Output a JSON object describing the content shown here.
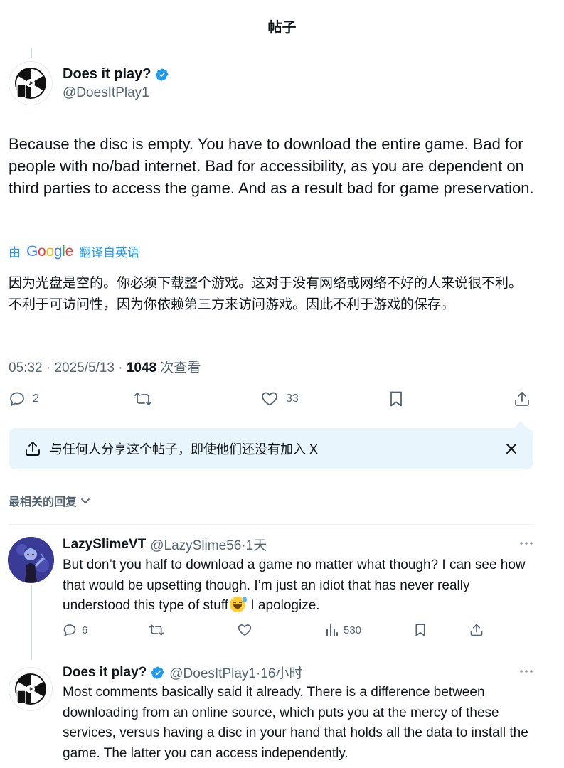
{
  "page": {
    "title": "帖子"
  },
  "post": {
    "author_name": "Does it play?",
    "author_handle": "@DoesItPlay1",
    "text": "Because the disc is empty. You have to download the entire game. Bad for people with no/bad internet. Bad for accessibility, as you are dependent on third parties to access the game. And as a result bad for game preservation.",
    "translate": {
      "by": "由",
      "provider_letters": [
        "G",
        "o",
        "o",
        "g",
        "l",
        "e"
      ],
      "action": "翻译自英语"
    },
    "translated_text": "因为光盘是空的。你必须下载整个游戏。这对于没有网络或网络不好的人来说很不利。不利于可访问性，因为你依赖第三方来访问游戏。因此不利于游戏的保存。",
    "time": "05:32",
    "date": "2025/5/13",
    "views_count": "1048",
    "views_label": "次查看",
    "replies": "2",
    "likes": "33"
  },
  "share_banner": {
    "text": "与任何人分享这个帖子，即使他们还没有加入 X"
  },
  "replies_sort": {
    "label": "最相关的回复"
  },
  "replies": [
    {
      "name": "LazySlimeVT",
      "handle": "@LazySlime56",
      "time": "1天",
      "text_before_emoji": "But don’t you half to download a game no matter what though? I can see how that would be upsetting though. I’m just an idiot that has never really understood this type of stuff",
      "emoji": "sweat-smile-emoji",
      "text_after_emoji": " I apologize.",
      "reply_count": "6",
      "view_count": "530"
    },
    {
      "name": "Does it play?",
      "handle": "@DoesItPlay1",
      "time": "16小时",
      "text": "Most comments basically said it already. There is a difference between downloading from an online source, which puts you at the mercy of these services, versus having a disc in your hand that holds all the data to install the game. The latter you can access independently."
    }
  ],
  "icons": {
    "verified": "verified-badge-icon",
    "reply": "reply-icon",
    "retweet": "retweet-icon",
    "like": "heart-icon",
    "bookmark": "bookmark-icon",
    "share": "share-icon",
    "close": "close-icon",
    "views": "views-icon",
    "more": "more-icon",
    "chevron": "chevron-down-icon"
  },
  "colors": {
    "accent": "#1d9bf0",
    "muted": "#536471",
    "banner_bg": "#e8f5fd"
  }
}
